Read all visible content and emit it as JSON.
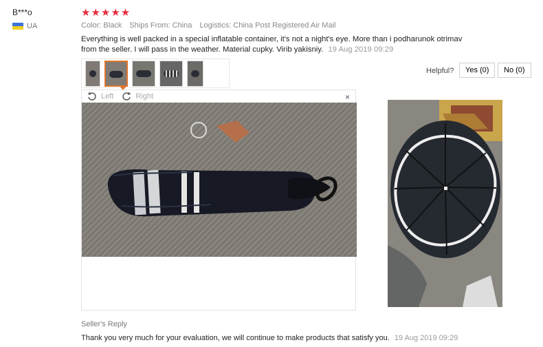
{
  "reviewer": {
    "name": "B***o",
    "country": "UA"
  },
  "rating": {
    "stars": 5,
    "display": "★★★★★"
  },
  "meta": {
    "color": "Color: Black",
    "ships_from": "Ships From: China",
    "logistics": "Logistics: China Post Registered Air Mail"
  },
  "review": {
    "text": "Everything is well packed in a special inflatable container, it's not a night's eye. More than i podharunok otrimav from the seller. I will pass in the weather. Material cupky. Virib yakisniy.",
    "date": "19 Aug 2019 09:29"
  },
  "helpful": {
    "label": "Helpful?",
    "yes": "Yes (0)",
    "no": "No (0)"
  },
  "viewer": {
    "left_label": "Left",
    "right_label": "Right",
    "close_label": "×"
  },
  "seller": {
    "title": "Seller's Reply",
    "reply": "Thank you very much for your evaluation, we will continue to make products that satisfy you.",
    "date": "19 Aug 2019 09:29"
  },
  "icons": {
    "rotate_left": "rotate-left-icon",
    "rotate_right": "rotate-right-icon",
    "close": "close-icon"
  },
  "colors": {
    "star": "#e62e3e",
    "active_thumb": "#e0752d"
  }
}
